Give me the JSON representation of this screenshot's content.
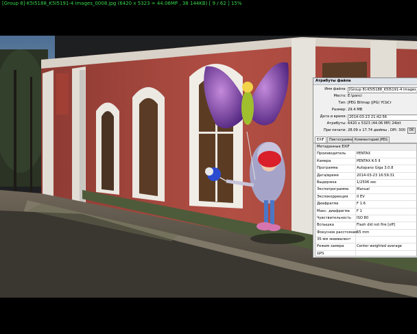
{
  "status_bar": {
    "text": "[Group 8]-K5I5188_K5I5191-4 images_0008.jpg  (6420 x 5323 = 44.06MP ,  38 144KB)  [ 9 / 62 ]   15%"
  },
  "viewer": {
    "mode": "fullscreen",
    "background": "#000000"
  },
  "attributes_panel": {
    "title": "Атрибуты файла",
    "rows": [
      {
        "key": "Имя файла:",
        "value": "[Group 8]-K5I5188_K5I5191-4 images_0008.jpg"
      },
      {
        "key": "Место:",
        "value": "E:\\panci"
      },
      {
        "key": "Тип:",
        "value": "JPEG Bitmap (JPG) YCbCr"
      },
      {
        "key": "Размер:",
        "value": "29.4 MB"
      },
      {
        "key": "Дата и время:",
        "value": "2014-03-23 21:42:56"
      },
      {
        "key": "Атрибуты:",
        "value": "6420 x 5323 (44.06 MP)  24bit"
      },
      {
        "key": "При печати:",
        "value": "28.09 x 17.74 дюймы ,  DPI: 300 x 300"
      }
    ],
    "ok_label": "OK",
    "tabs": [
      "EXIF",
      "Пиктограмма",
      "Комментарий JPEG"
    ],
    "active_tab": "EXIF",
    "exif_header": "Метаданные EXIF",
    "exif_rows": [
      {
        "key": "Производитель",
        "value": "PENTAX"
      },
      {
        "key": "Камера",
        "value": "PENTAX K-5 II"
      },
      {
        "key": "Программа",
        "value": "Autopano Giga 3.0.8"
      },
      {
        "key": "Дата/время",
        "value": "2014-03-23 16:59:31"
      },
      {
        "key": "Выдержка",
        "value": "1/2506 sec"
      },
      {
        "key": "Экспопрограмма",
        "value": "Manual"
      },
      {
        "key": "Экспокоррекция",
        "value": "0 EV"
      },
      {
        "key": "Диафрагма",
        "value": "F 1.6"
      },
      {
        "key": "Макс. диафрагма",
        "value": "F 1"
      },
      {
        "key": "Чувствительность",
        "value": "ISO 80"
      },
      {
        "key": "Вспышка",
        "value": "Flash did not fire [off]"
      },
      {
        "key": "Фокусное расстояние",
        "value": "55 mm"
      },
      {
        "key": "35-мм эквивалент",
        "value": ""
      },
      {
        "key": "Режим замера",
        "value": "Center weighted average"
      },
      {
        "key": "GPS",
        "value": ""
      }
    ]
  },
  "colors": {
    "status_text": "#37d84a",
    "wall_red": "#b34a40",
    "window_white": "#e9e6e1",
    "panel_bg": "#f0f0f0"
  }
}
